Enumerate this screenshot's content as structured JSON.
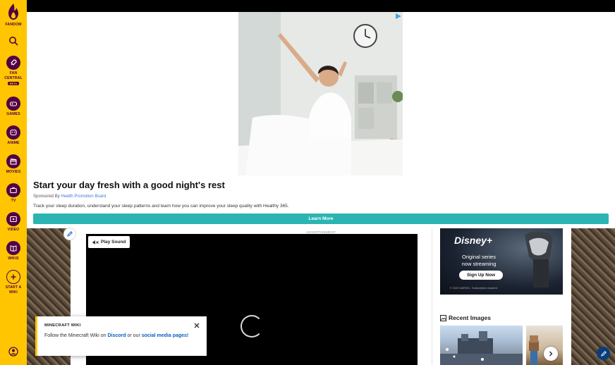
{
  "rail": {
    "brand": "FANDOM",
    "items": [
      {
        "label": "FAN\nCENTRAL",
        "badge": "BETA",
        "icon": "rocket-icon"
      },
      {
        "label": "GAMES",
        "icon": "gamepad-icon"
      },
      {
        "label": "ANIME",
        "icon": "anime-face-icon"
      },
      {
        "label": "MOVIES",
        "icon": "clapperboard-icon"
      },
      {
        "label": "TV",
        "icon": "tv-icon"
      },
      {
        "label": "VIDEO",
        "icon": "play-icon"
      },
      {
        "label": "WIKIS",
        "icon": "book-icon"
      },
      {
        "label": "START A\nWIKI",
        "icon": "plus-circle-icon"
      }
    ]
  },
  "ad": {
    "title": "Start your day fresh with a good night's rest",
    "sponsor_prefix": "Sponsored By",
    "sponsor_name": "Health Promotion Board",
    "description": "Track your sleep duration, understand your sleep patterns and learn how you can improve your sleep quality with Healthy 365.",
    "button": "Learn More",
    "badge_icon": "adchoices-icon"
  },
  "advertisement_label": "ADVERTISEMENT",
  "video": {
    "play_sound": "Play Sound"
  },
  "disney": {
    "line1": "Original series",
    "line2": "now streaming",
    "button": "Sign Up Now",
    "fine": "© 2022 MARVEL. Subscription required."
  },
  "recent_images": {
    "title": "Recent Images"
  },
  "popup": {
    "title": "MINECRAFT WIKI",
    "text_1": "Follow the Minecraft Wiki on ",
    "link_1": "Discord",
    "text_2": " or our ",
    "link_2": "social media pages!"
  },
  "colors": {
    "fandom_yellow": "#FFC500",
    "fandom_purple": "#520044",
    "ad_button": "#2bb5b2"
  }
}
